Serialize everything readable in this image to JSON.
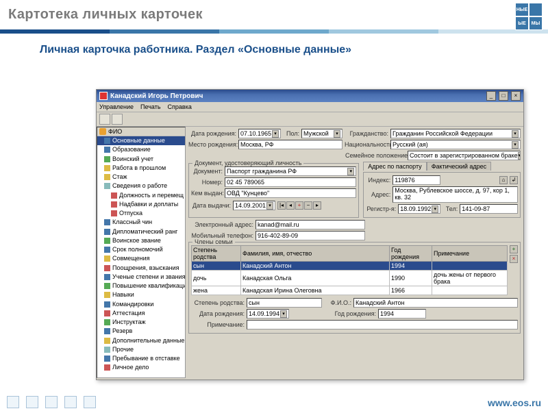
{
  "slide": {
    "title": "Картотека личных карточек",
    "subtitle": "Личная карточка работника. Раздел «Основные данные»",
    "footer_url": "www.eos.ru"
  },
  "window": {
    "title": "Канадский Игорь Петрович",
    "menu": {
      "manage": "Управление",
      "print": "Печать",
      "help": "Справка"
    }
  },
  "tree": {
    "root_label": "ФИО",
    "items": [
      {
        "label": "Основные данные",
        "sel": true,
        "cls": "blue"
      },
      {
        "label": "Образование",
        "cls": "blue"
      },
      {
        "label": "Воинский учет",
        "cls": "green"
      },
      {
        "label": "Работа в прошлом",
        "cls": "yellow"
      },
      {
        "label": "Стаж",
        "cls": "yellow"
      },
      {
        "label": "Сведения о работе",
        "cls": ""
      },
      {
        "label": "Должность и перемещ",
        "lvl": 2,
        "cls": "red"
      },
      {
        "label": "Надбавки и доплаты",
        "lvl": 2,
        "cls": "red"
      },
      {
        "label": "Отпуска",
        "lvl": 2,
        "cls": "red"
      },
      {
        "label": "Классный чин",
        "cls": "blue"
      },
      {
        "label": "Дипломатический ранг",
        "cls": "blue"
      },
      {
        "label": "Воинское звание",
        "cls": "green"
      },
      {
        "label": "Срок полномочий",
        "cls": "blue"
      },
      {
        "label": "Совмещения",
        "cls": "yellow"
      },
      {
        "label": "Поощрения, взыскания",
        "cls": "red"
      },
      {
        "label": "Ученые степени и звания",
        "cls": "blue"
      },
      {
        "label": "Повышение квалификации",
        "cls": "green"
      },
      {
        "label": "Навыки",
        "cls": "yellow"
      },
      {
        "label": "Командировки",
        "cls": "blue"
      },
      {
        "label": "Аттестация",
        "cls": "red"
      },
      {
        "label": "Инструктаж",
        "cls": "green"
      },
      {
        "label": "Резерв",
        "cls": "blue"
      },
      {
        "label": "Дополнительные данные",
        "cls": "yellow"
      },
      {
        "label": "Прочие",
        "cls": ""
      },
      {
        "label": "Пребывание в отставке",
        "cls": "blue"
      },
      {
        "label": "Личное дело",
        "cls": "red"
      }
    ]
  },
  "form": {
    "labels": {
      "dob": "Дата рождения:",
      "sex": "Пол:",
      "citizenship": "Гражданство:",
      "birthplace": "Место рождения:",
      "nationality": "Национальность:",
      "marital": "Семейное положение:",
      "doc_group": "Документ, удостоверяющий личность",
      "document": "Документ:",
      "number": "Номер:",
      "issued_by": "Кем выдан:",
      "issue_date": "Дата выдачи:",
      "tab_passport": "Адрес по паспорту",
      "tab_actual": "Фактический адрес",
      "index": "Индекс:",
      "address": "Адрес:",
      "reg_date": "Регистр-я:",
      "tel": "Тел:",
      "email": "Электронный адрес:",
      "mobile": "Мобильный телефон:",
      "family_group": "Члены семьи",
      "col_relation": "Степень родства",
      "col_fio": "Фамилия, имя, отчество",
      "col_year": "Год рождения",
      "col_note": "Примечание",
      "relation": "Степень родства:",
      "fio": "Ф.И.О.:",
      "dob2": "Дата рождения:",
      "year": "Год рождения:",
      "note": "Примечание:"
    },
    "values": {
      "dob": "07.10.1965",
      "sex": "Мужской",
      "citizenship": "Гражданин Российской Федерации",
      "birthplace": "Москва, РФ",
      "nationality": "Русский (ая)",
      "marital": "Состоит в зарегистрированном браке",
      "document": "Паспорт гражданина РФ",
      "number": "02 45 789065",
      "issued_by": "ОВД \"Кунцево\"",
      "issue_date": "14.09.2001",
      "index": "119876",
      "address": "Москва, Рублевское шоссе, д. 97, кор 1, кв. 32",
      "reg_date": "18.09.1992",
      "tel": "141-09-87",
      "email": "kanad@mail.ru",
      "mobile": "916-402-89-09",
      "detail_relation": "сын",
      "detail_fio": "Канадский Антон",
      "detail_dob": "14.09.1994",
      "detail_year": "1994",
      "detail_note": ""
    },
    "family_rows": [
      {
        "relation": "сын",
        "fio": "Канадский Антон",
        "year": "1994",
        "note": "",
        "sel": true
      },
      {
        "relation": "дочь",
        "fio": "Канадская Ольга",
        "year": "1990",
        "note": "дочь жены от первого брака"
      },
      {
        "relation": "жена",
        "fio": "Канадская Ирина Олеговна",
        "year": "1966",
        "note": ""
      }
    ]
  }
}
